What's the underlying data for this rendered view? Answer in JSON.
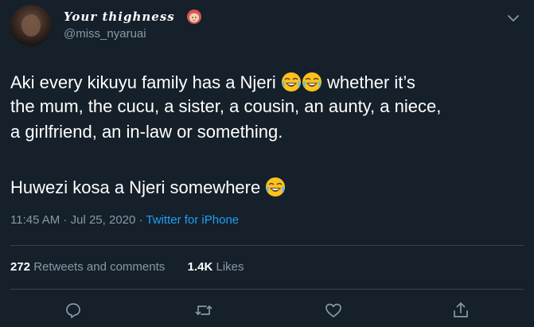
{
  "user": {
    "display_name": "Your thighness",
    "handle": "@miss_nyaruai"
  },
  "tweet": {
    "line1_before": "Aki every kikuyu family has a Njeri ",
    "line1_after": " whether it’s",
    "line2": "the mum, the cucu, a sister, a cousin, an aunty, a niece,",
    "line3": "a girlfriend, an in-law or something.",
    "line4": "Huwezi kosa a Njeri somewhere "
  },
  "meta": {
    "time": "11:45 AM",
    "sep1": " · ",
    "date": "Jul 25, 2020",
    "sep2": " · ",
    "source": "Twitter for iPhone"
  },
  "stats": {
    "retweets_count": "272",
    "retweets_label": " Retweets and comments",
    "likes_count": "1.4K",
    "likes_label": " Likes"
  },
  "icons": {
    "name_emoji": "woman-emoji",
    "tweet_emoji": "face-with-tears-of-joy",
    "menu": "chevron-down-icon",
    "reply": "reply-icon",
    "retweet": "retweet-icon",
    "like": "heart-icon",
    "share": "share-icon"
  },
  "colors": {
    "background": "#15202b",
    "text": "#ffffff",
    "secondary": "#8899a6",
    "link": "#1da1f2",
    "divider": "#38444d"
  }
}
